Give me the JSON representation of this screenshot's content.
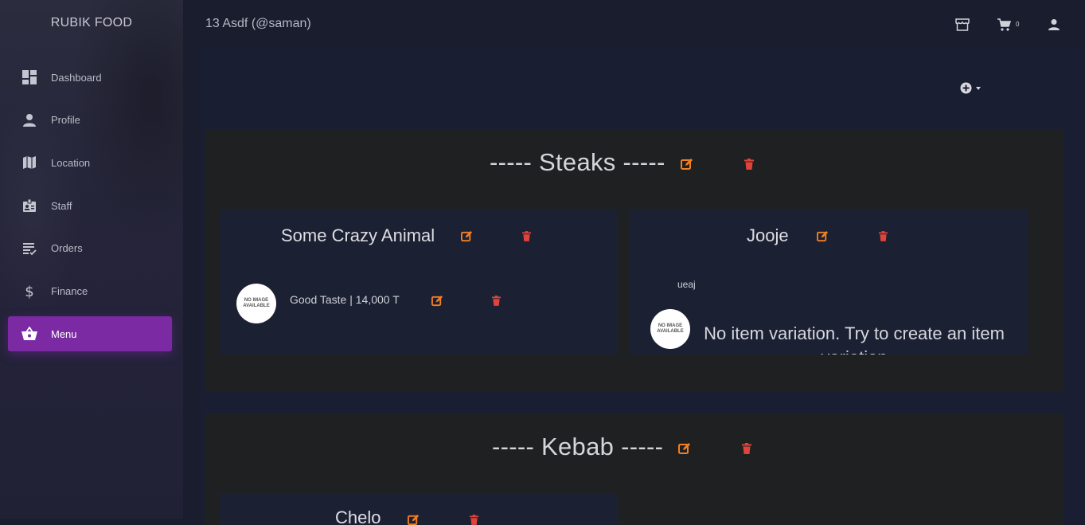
{
  "app": {
    "brand": "RUBIK FOOD",
    "header_title": "13 Asdf (@saman)",
    "cart_count": "0"
  },
  "sidebar": {
    "items": [
      {
        "label": "Dashboard",
        "icon": "dashboard-icon"
      },
      {
        "label": "Profile",
        "icon": "person-icon"
      },
      {
        "label": "Location",
        "icon": "map-icon"
      },
      {
        "label": "Staff",
        "icon": "badge-icon"
      },
      {
        "label": "Orders",
        "icon": "receipt-list-icon"
      },
      {
        "label": "Finance",
        "icon": "dollar-icon"
      },
      {
        "label": "Menu",
        "icon": "basket-icon",
        "active": true
      }
    ]
  },
  "colors": {
    "accent": "#7b2aa3",
    "edit": "#f47f20",
    "delete": "#e0433a"
  },
  "categories": [
    {
      "title": "----- Steaks -----",
      "items": [
        {
          "name": "Some Crazy Animal",
          "variations": [
            {
              "image_text": "NO IMAGE AVAILABLE",
              "label": "Good Taste | 14,000 T"
            }
          ]
        },
        {
          "name": "Jooje",
          "description": "ueaj",
          "image_text": "NO IMAGE AVAILABLE",
          "empty_message": "No item variation. Try to create an item variation"
        }
      ]
    },
    {
      "title": "----- Kebab -----",
      "items": [
        {
          "name": "Chelo"
        }
      ]
    }
  ]
}
